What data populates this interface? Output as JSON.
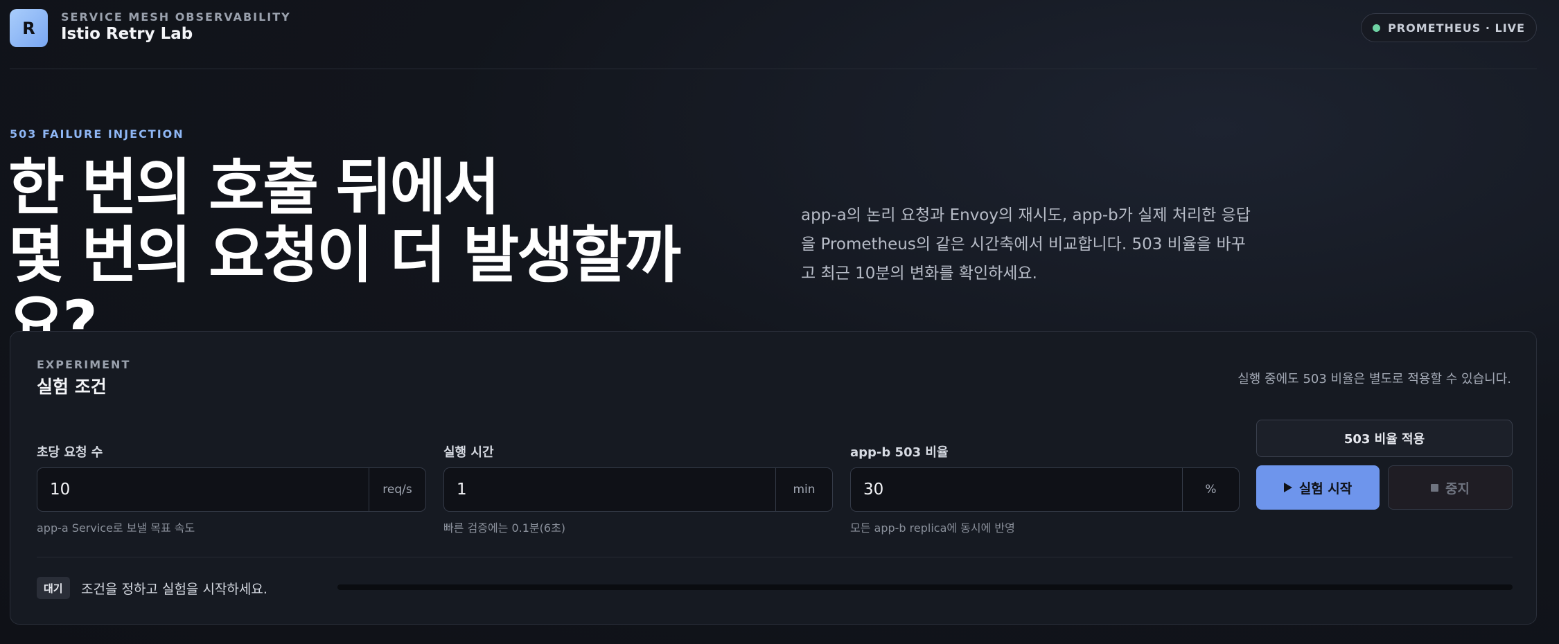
{
  "header": {
    "logo_letter": "R",
    "eyebrow": "SERVICE MESH OBSERVABILITY",
    "title": "Istio Retry Lab",
    "status": "PROMETHEUS · LIVE"
  },
  "hero": {
    "eyebrow": "503 FAILURE INJECTION",
    "title_line1": "한 번의 호출 뒤에서",
    "title_line2": "몇 번의 요청이 더 발생할까요?",
    "description": "app-a의 논리 요청과 Envoy의 재시도, app-b가 실제 처리한 응답을 Prometheus의 같은 시간축에서 비교합니다. 503 비율을 바꾸고 최근 10분의 변화를 확인하세요."
  },
  "experiment": {
    "eyebrow": "EXPERIMENT",
    "title": "실험 조건",
    "note": "실행 중에도 503 비율은 별도로 적용할 수 있습니다.",
    "fields": [
      {
        "label": "초당 요청 수",
        "value": "10",
        "unit": "req/s",
        "hint": "app-a Service로 보낼 목표 속도"
      },
      {
        "label": "실행 시간",
        "value": "1",
        "unit": "min",
        "hint": "빠른 검증에는 0.1분(6초)"
      },
      {
        "label": "app-b 503 비율",
        "value": "30",
        "unit": "%",
        "hint": "모든 app-b replica에 동시에 반영"
      }
    ],
    "apply_label": "503 비율 적용",
    "start_label": "실험 시작",
    "stop_label": "중지",
    "state_badge": "대기",
    "state_text": "조건을 정하고 실험을 시작하세요.",
    "progress": 0
  },
  "colors": {
    "accent": "#6e95ec",
    "live": "#6fd3a4"
  }
}
